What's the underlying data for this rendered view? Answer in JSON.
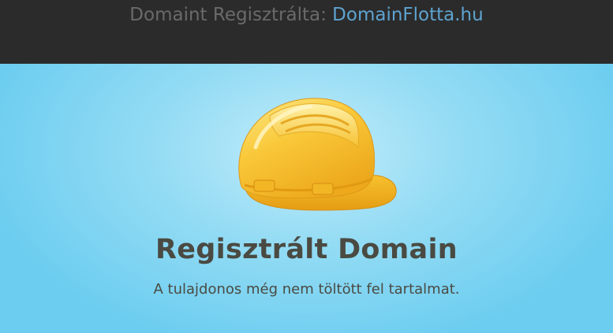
{
  "header": {
    "prefix": "Domaint Regisztrálta:",
    "link": "DomainFlotta.hu"
  },
  "main": {
    "icon": "hard-hat-icon",
    "title": "Regisztrált Domain",
    "subtitle": "A tulajdonos még nem töltött fel tartalmat."
  },
  "colors": {
    "header_bg": "#2b2b2b",
    "header_text": "#6a6a6a",
    "link": "#5ea3cf",
    "bg": "#6ccdf0",
    "helmet": "#f7c531",
    "text": "#4a4a42"
  }
}
